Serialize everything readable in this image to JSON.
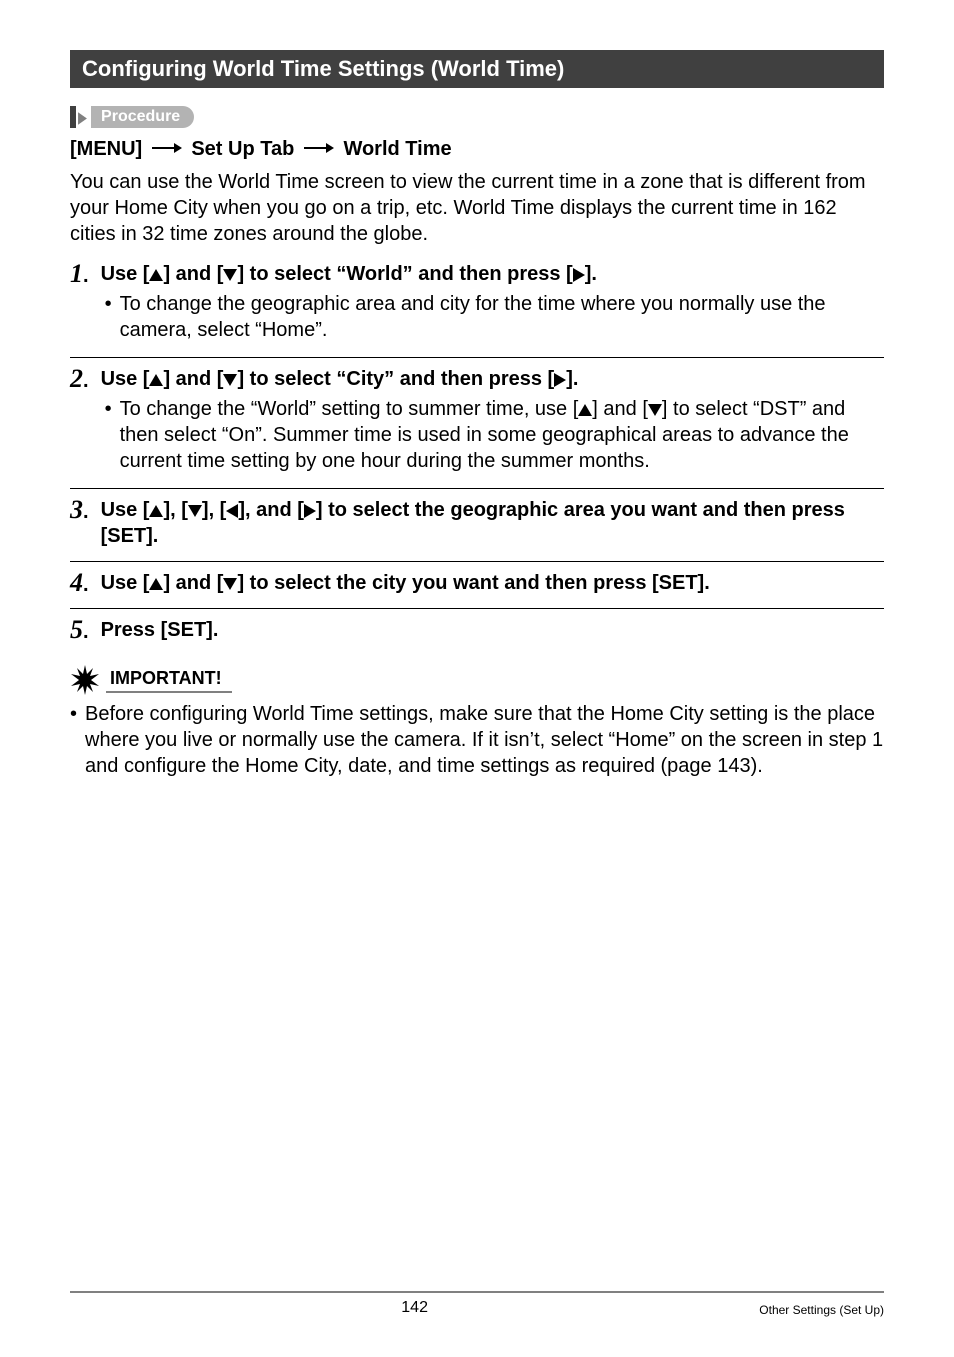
{
  "header": {
    "title": "Configuring World Time Settings (World Time)"
  },
  "procedure": {
    "label": "Procedure",
    "menu_label": "[MENU]",
    "setup_tab": "Set Up Tab",
    "world_time": "World Time"
  },
  "intro": "You can use the World Time screen to view the current time in a zone that is different from your Home City when you go on a trip, etc. World Time displays the current time in 162 cities in 32 time zones around the globe.",
  "steps": [
    {
      "num": "1",
      "title_parts": {
        "p1": "Use [",
        "p2": "] and [",
        "p3": "] to select “World” and then press [",
        "p4": "]."
      },
      "bullet": "To change the geographic area and city for the time where you normally use the camera, select “Home”."
    },
    {
      "num": "2",
      "title_parts": {
        "p1": "Use [",
        "p2": "] and [",
        "p3": "] to select “City” and then press [",
        "p4": "]."
      },
      "bullet_parts": {
        "p1": "To change the “World” setting to summer time, use [",
        "p2": "] and [",
        "p3": "] to select “DST” and then select “On”. Summer time is used in some geographical areas to advance the current time setting by one hour during the summer months."
      }
    },
    {
      "num": "3",
      "title_parts": {
        "p1": "Use [",
        "p2": "], [",
        "p3": "], [",
        "p4": "], and [",
        "p5": "] to select the geographic area you want and then press [SET]."
      }
    },
    {
      "num": "4",
      "title_parts": {
        "p1": "Use [",
        "p2": "] and [",
        "p3": "] to select the city you want and then press [SET]."
      }
    },
    {
      "num": "5",
      "title": "Press [SET]."
    }
  ],
  "important": {
    "label": "IMPORTANT!",
    "bullet": "Before configuring World Time settings, make sure that the Home City setting is the place where you live or normally use the camera. If it isn’t, select “Home” on the screen in step 1 and configure the Home City, date, and time settings as required (page 143)."
  },
  "footer": {
    "page": "142",
    "section": "Other Settings (Set Up)"
  },
  "icons": {
    "up": "up-triangle-icon",
    "down": "down-triangle-icon",
    "left": "left-triangle-icon",
    "right": "right-triangle-icon",
    "arrow": "right-arrow-icon",
    "starburst": "starburst-icon"
  }
}
